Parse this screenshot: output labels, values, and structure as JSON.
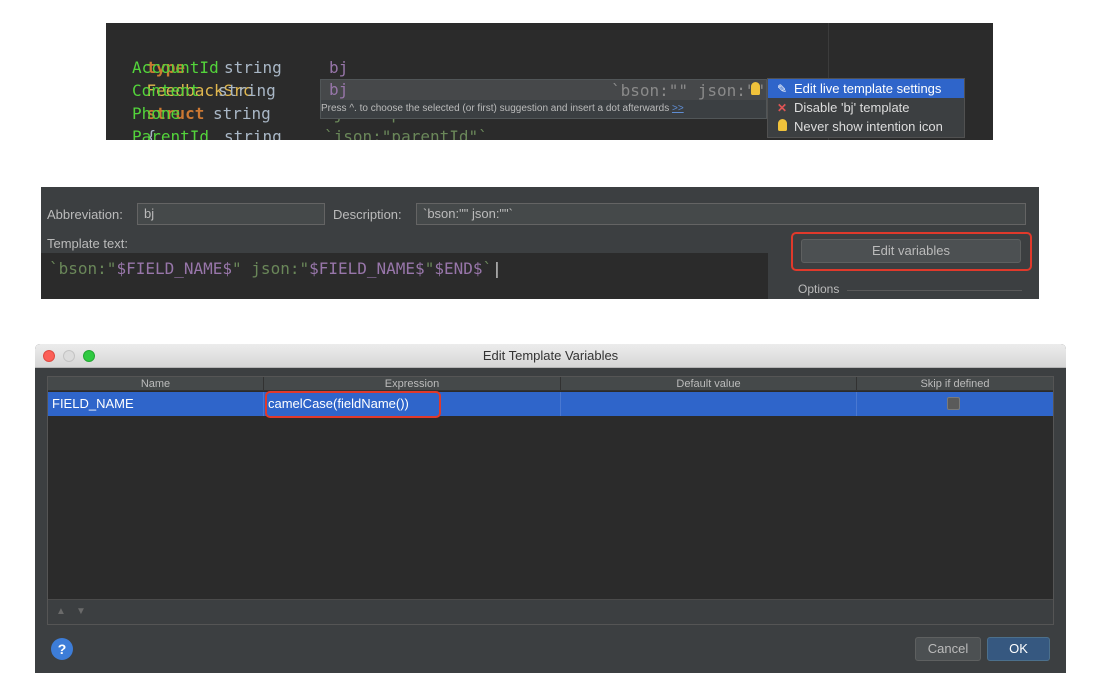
{
  "editor": {
    "line1": {
      "kw_type": "type",
      "name": "FeedbackSrc",
      "kw_struct": "struct",
      "brace": "{"
    },
    "rows": [
      {
        "field": "AccountId",
        "type": "string",
        "tag": "bj"
      },
      {
        "field": "Content",
        "type": "string",
        "tag": "bj"
      },
      {
        "field": "Phone",
        "type": "string",
        "tag": "`json:\"phone\""
      },
      {
        "field": "ParentId",
        "type": "string",
        "tag": "`json:\"parentId\"`"
      }
    ],
    "completion": {
      "item_text": "`bson:\"\" json:\"\"",
      "hint": "Press ^. to choose the selected (or first) suggestion and insert a dot afterwards",
      "hint_link": ">>"
    },
    "context_menu": [
      {
        "icon": "pencil-icon",
        "label": "Edit live template settings",
        "selected": true
      },
      {
        "icon": "cross-icon",
        "label": "Disable 'bj' template",
        "selected": false
      },
      {
        "icon": "bulb-icon",
        "label": "Never show intention icon",
        "selected": false
      }
    ]
  },
  "template_editor": {
    "abbreviation_label": "Abbreviation:",
    "abbreviation_value": "bj",
    "description_label": "Description:",
    "description_value": "`bson:\"\" json:\"\"`",
    "template_text_label": "Template text:",
    "template_text": {
      "p1": "`bson:\"",
      "v1": "$FIELD_NAME$",
      "p2": "\" json:\"",
      "v2": "$FIELD_NAME$",
      "p3": "\"",
      "v3": "$END$",
      "p4": "`"
    },
    "edit_variables_button": "Edit variables",
    "options_label": "Options"
  },
  "dialog": {
    "title": "Edit Template Variables",
    "columns": [
      "Name",
      "Expression",
      "Default value",
      "Skip if defined"
    ],
    "rows": [
      {
        "name": "FIELD_NAME",
        "expression": "camelCase(fieldName())",
        "default_value": "",
        "skip_if_defined": false
      }
    ],
    "help_label": "?",
    "cancel_label": "Cancel",
    "ok_label": "OK"
  },
  "colors": {
    "accent_selection": "#2f65ca",
    "highlight_box": "#e0392b",
    "editor_bg": "#2b2b2b",
    "panel_bg": "#3c3f41"
  }
}
